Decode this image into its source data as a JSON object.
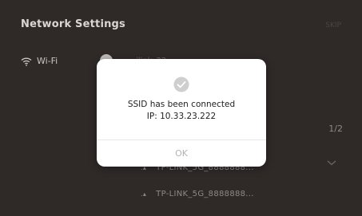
{
  "header": {
    "title": "Network Settings",
    "top_right": "SKIP"
  },
  "wifi": {
    "label": "Wi-Fi",
    "connected_ssid": "ilink_22"
  },
  "list": {
    "page": "1/2",
    "networks": [
      "TP-LINK_5G_8888888...",
      "TP-LINK_5G_8888888..."
    ]
  },
  "dialog": {
    "line1": "SSID has been connected",
    "line2": "IP: 10.33.23.222",
    "ok_label": "OK",
    "icon": "check-circle-icon"
  },
  "colors": {
    "background": "#2f2928",
    "dialog": "#ffffff",
    "check": "#cfcfcf"
  }
}
